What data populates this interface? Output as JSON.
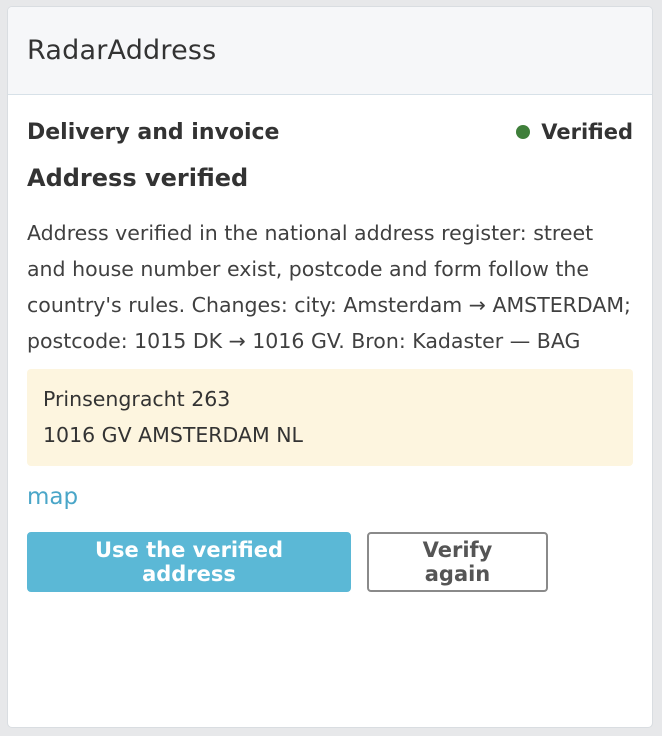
{
  "panel": {
    "title": "RadarAddress"
  },
  "section": {
    "label": "Delivery and invoice",
    "status_label": "Verified",
    "status_color": "#3f7f3a"
  },
  "result": {
    "headline": "Address verified",
    "description": "Address verified in the national address register: street and house number exist, postcode and form follow the country's rules. Changes: city: Amsterdam → AMSTERDAM; postcode: 1015 DK → 1016 GV. Bron: Kadaster — BAG"
  },
  "address": {
    "line1": "Prinsengracht 263",
    "line2": "1016 GV AMSTERDAM NL"
  },
  "links": {
    "map_label": "map"
  },
  "actions": {
    "use_verified_label": "Use the verified address",
    "verify_again_label": "Verify again"
  },
  "colors": {
    "accent": "#5bb8d6",
    "link": "#4aa6c8",
    "address_background": "#fdf5df"
  }
}
